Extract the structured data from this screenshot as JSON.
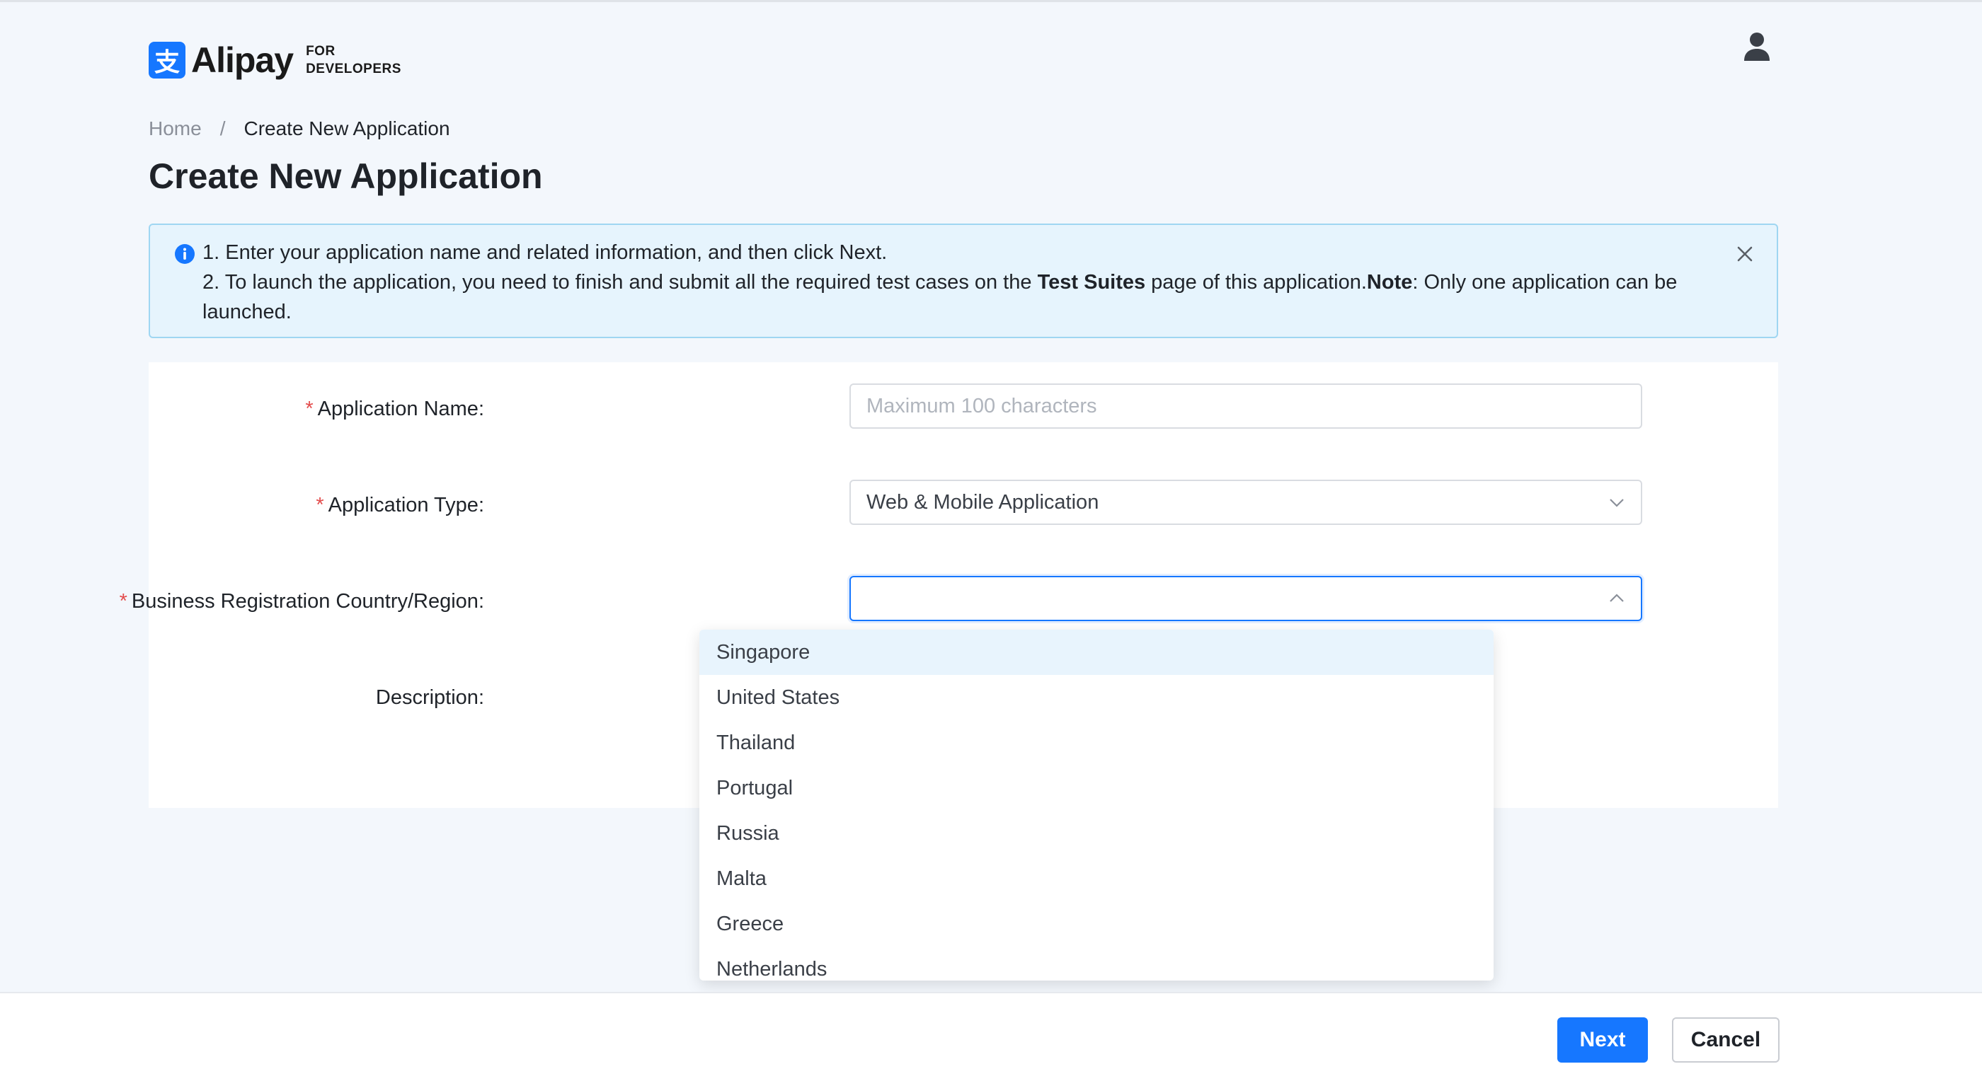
{
  "header": {
    "logo_glyph": "支",
    "logo_text": "Alipay",
    "logo_sub_line1": "FOR",
    "logo_sub_line2": "DEVELOPERS",
    "user_icon": "user-icon"
  },
  "breadcrumb": {
    "home": "Home",
    "separator": "/",
    "current": "Create New Application"
  },
  "page_title": "Create New Application",
  "alert": {
    "line1": "1. Enter your application name and related information, and then click Next.",
    "line2_prefix": "2. To launch the application, you need to finish and submit all the required test cases on the ",
    "line2_bold": "Test Suites",
    "line2_middle": " page of this application.",
    "note_label": "Note",
    "line2_suffix": ": Only one application can be launched."
  },
  "form": {
    "required_mark": "*",
    "app_name": {
      "label": "Application Name",
      "placeholder": "Maximum 100 characters",
      "value": ""
    },
    "app_type": {
      "label": "Application Type",
      "value": "Web & Mobile Application"
    },
    "country": {
      "label": "Business Registration Country/Region",
      "value": ""
    },
    "description": {
      "label": "Description"
    },
    "colon": ":"
  },
  "dropdown": {
    "options": [
      "Singapore",
      "United States",
      "Thailand",
      "Portugal",
      "Russia",
      "Malta",
      "Greece",
      "Netherlands"
    ]
  },
  "footer": {
    "next_label": "Next",
    "cancel_label": "Cancel"
  },
  "colors": {
    "primary": "#1677ff",
    "required": "#e34d4d",
    "alert_bg": "#e6f4fd",
    "active_option_bg": "#e8f4fd"
  }
}
